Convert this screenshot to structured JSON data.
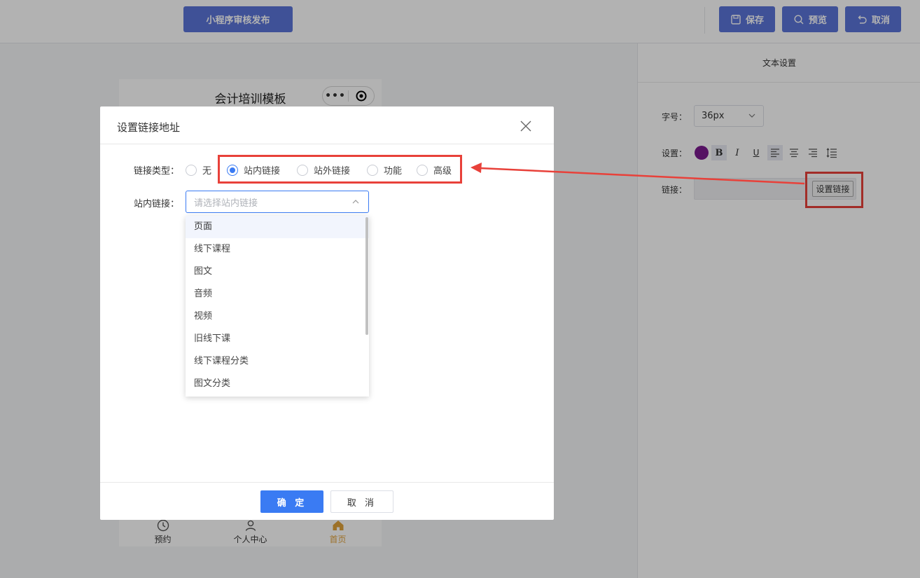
{
  "topbar": {
    "publish_label": "小程序审核发布",
    "save_label": "保存",
    "preview_label": "预览",
    "cancel_label": "取消"
  },
  "phone": {
    "title": "会计培训模板",
    "capsule_more": "•••",
    "tabs": [
      {
        "label": "预约",
        "icon": "clock-icon"
      },
      {
        "label": "个人中心",
        "icon": "user-icon"
      },
      {
        "label": "首页",
        "icon": "home-icon"
      }
    ]
  },
  "right_panel": {
    "title": "文本设置",
    "font_size_label": "字号：",
    "font_size_value": "36px",
    "settings_label": "设置：",
    "text_color": "#7a1b8f",
    "link_label": "链接：",
    "set_link_button": "设置链接"
  },
  "dialog": {
    "title": "设置链接地址",
    "link_type_label": "链接类型：",
    "link_types": [
      "无",
      "站内链接",
      "站外链接",
      "功能",
      "高级"
    ],
    "selected_type": "站内链接",
    "internal_link_label": "站内链接：",
    "select_placeholder": "请选择站内链接",
    "options": [
      "页面",
      "线下课程",
      "图文",
      "音频",
      "视频",
      "旧线下课",
      "线下课程分类",
      "图文分类"
    ],
    "ok_label": "确 定",
    "cancel_label": "取 消"
  },
  "colors": {
    "primary": "#3a7bf3",
    "toolbar_button": "#5b74d8",
    "highlight": "#e8413a",
    "active_tab": "#e0a23c"
  }
}
